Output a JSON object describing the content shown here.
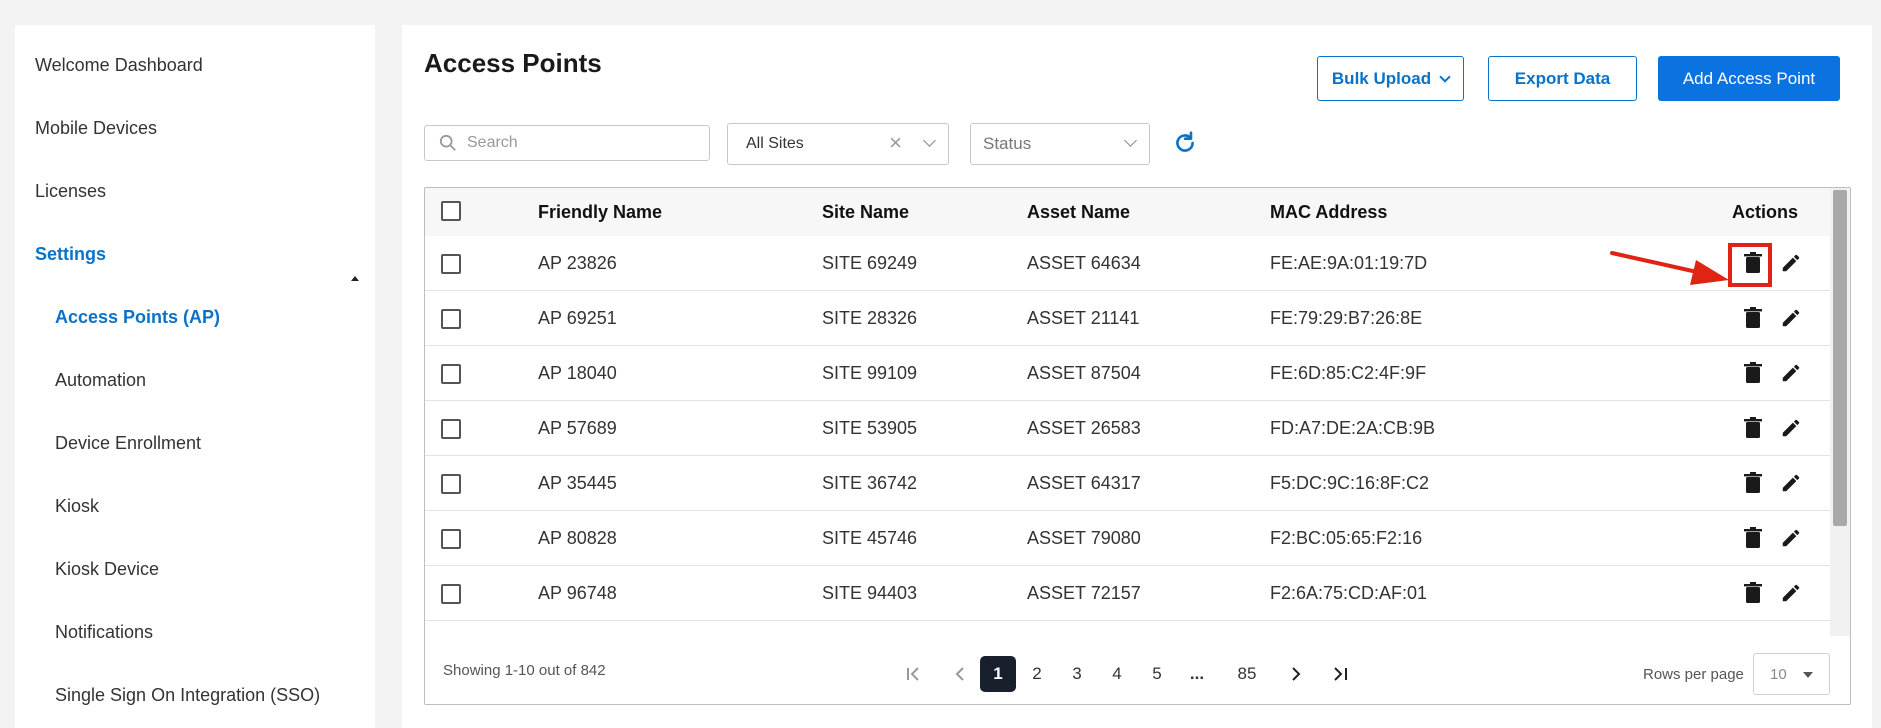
{
  "sidebar": {
    "items": [
      {
        "label": "Welcome Dashboard"
      },
      {
        "label": "Mobile Devices"
      },
      {
        "label": "Licenses"
      },
      {
        "label": "Settings"
      },
      {
        "label": "Access Points (AP)"
      },
      {
        "label": "Automation"
      },
      {
        "label": "Device Enrollment"
      },
      {
        "label": "Kiosk"
      },
      {
        "label": "Kiosk Device"
      },
      {
        "label": "Notifications"
      },
      {
        "label": "Single Sign On Integration (SSO)"
      }
    ]
  },
  "header": {
    "title": "Access Points",
    "bulk_upload_label": "Bulk Upload",
    "export_label": "Export Data",
    "add_label": "Add Access Point"
  },
  "filters": {
    "search_placeholder": "Search",
    "site_value": "All Sites",
    "status_placeholder": "Status"
  },
  "table": {
    "columns": [
      "Friendly Name",
      "Site Name",
      "Asset Name",
      "MAC Address",
      "Actions"
    ],
    "rows": [
      {
        "friendly": "AP  23826",
        "site": "SITE  69249",
        "asset": "ASSET  64634",
        "mac": "FE:AE:9A:01:19:7D"
      },
      {
        "friendly": "AP  69251",
        "site": "SITE  28326",
        "asset": "ASSET  21141",
        "mac": "FE:79:29:B7:26:8E"
      },
      {
        "friendly": "AP  18040",
        "site": "SITE  99109",
        "asset": "ASSET  87504",
        "mac": "FE:6D:85:C2:4F:9F"
      },
      {
        "friendly": "AP  57689",
        "site": "SITE  53905",
        "asset": "ASSET  26583",
        "mac": "FD:A7:DE:2A:CB:9B"
      },
      {
        "friendly": "AP  35445",
        "site": "SITE  36742",
        "asset": "ASSET  64317",
        "mac": "F5:DC:9C:16:8F:C2"
      },
      {
        "friendly": "AP  80828",
        "site": "SITE  45746",
        "asset": "ASSET  79080",
        "mac": "F2:BC:05:65:F2:16"
      },
      {
        "friendly": "AP  96748",
        "site": "SITE  94403",
        "asset": "ASSET  72157",
        "mac": "F2:6A:75:CD:AF:01"
      }
    ]
  },
  "footer": {
    "showing": "Showing 1-10 out of 842",
    "pages": [
      "1",
      "2",
      "3",
      "4",
      "5",
      "...",
      "85"
    ],
    "rows_per_page_label": "Rows per page",
    "rows_per_page_value": "10"
  },
  "icons": {
    "delete": "trash-icon",
    "edit": "pencil-icon",
    "refresh": "refresh-icon",
    "search": "search-icon"
  },
  "colors": {
    "accent": "#0a73c7",
    "primary_button": "#0a73e0",
    "highlight": "#e02414"
  }
}
